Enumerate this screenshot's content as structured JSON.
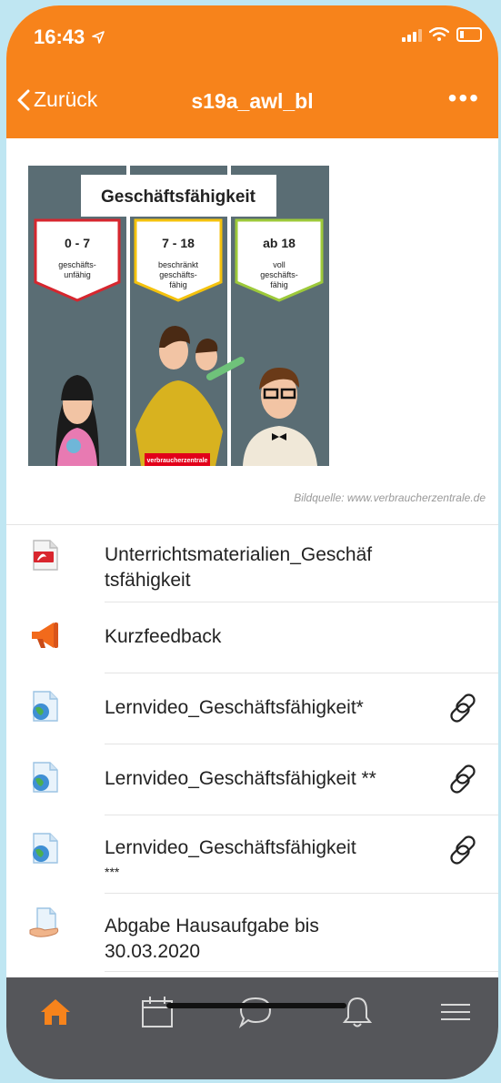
{
  "status_bar": {
    "time": "16:43"
  },
  "nav": {
    "back_label": "Zurück",
    "title": "s19a_awl_bl",
    "more_label": "•••"
  },
  "illustration": {
    "title": "Geschäftsfähigkeit",
    "panels": [
      {
        "range": "0 - 7",
        "line1": "geschäfts-",
        "line2": "unfähig",
        "line3": "",
        "color": "#d6262e"
      },
      {
        "range": "7 - 18",
        "line1": "beschränkt",
        "line2": "geschäfts-",
        "line3": "fähig",
        "color": "#f4c20d"
      },
      {
        "range": "ab 18",
        "line1": "voll",
        "line2": "geschäfts-",
        "line3": "fähig",
        "color": "#9dc93a"
      }
    ],
    "logo_text": "verbraucherzentrale",
    "caption": "Bildquelle: www.verbraucherzentrale.de"
  },
  "items": [
    {
      "label_line1": "Unterrichtsmaterialien_Geschäf",
      "label_line2": "tsfähigkeit",
      "icon": "pdf-icon"
    },
    {
      "label_line1": "Kurzfeedback",
      "label_line2": "",
      "icon": "megaphone-icon"
    },
    {
      "label_line1": "Lernvideo_Geschäftsfähigkeit*",
      "label_line2": "",
      "icon": "web-page-icon"
    },
    {
      "label_line1": "Lernvideo_Geschäftsfähigkeit **",
      "label_line2": "",
      "icon": "web-page-icon"
    },
    {
      "label_line1": "Lernvideo_Geschäftsfähigkeit",
      "label_line2": "***",
      "icon": "web-page-icon"
    },
    {
      "label_line1": "Abgabe Hausaufgabe bis",
      "label_line2": "30.03.2020",
      "icon": "assignment-icon"
    }
  ],
  "colors": {
    "accent": "#f7831b",
    "tab_bar": "#55565a",
    "tab_active": "#f7831b"
  },
  "tabs": [
    "home-icon",
    "calendar-icon",
    "chat-icon",
    "bell-icon",
    "menu-icon"
  ]
}
